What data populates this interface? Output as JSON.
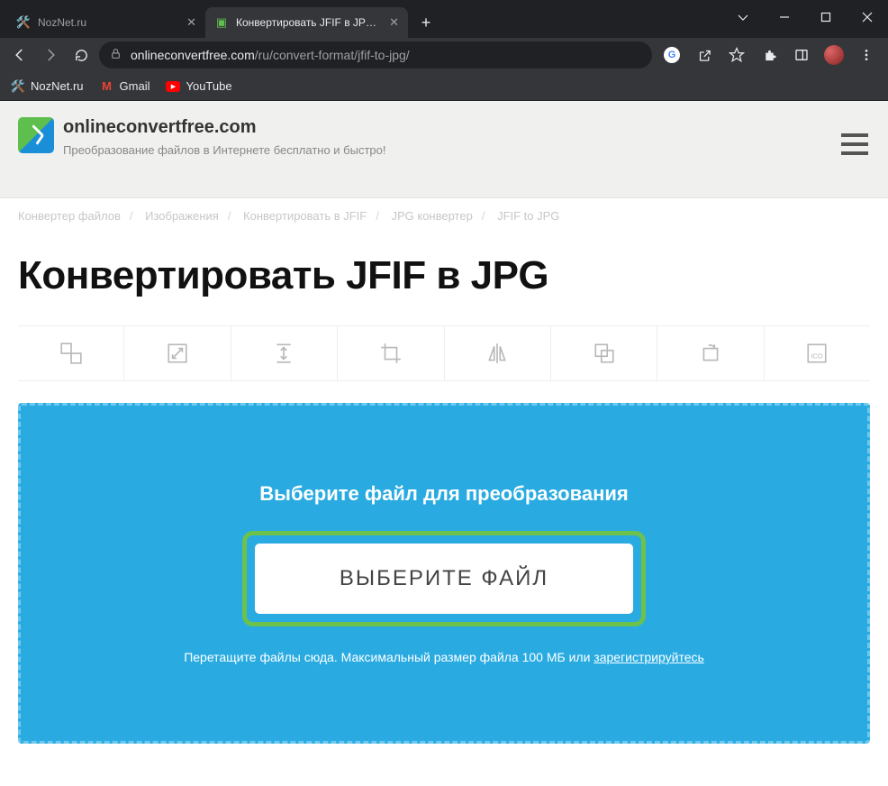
{
  "tabs": [
    {
      "title": "NozNet.ru"
    },
    {
      "title": "Конвертировать JFIF в JPG онла"
    }
  ],
  "url": {
    "host": "onlineconvertfree.com",
    "path": "/ru/convert-format/jfif-to-jpg/"
  },
  "bookmarks": [
    {
      "label": "NozNet.ru"
    },
    {
      "label": "Gmail"
    },
    {
      "label": "YouTube"
    }
  ],
  "site": {
    "title": "onlineconvertfree.com",
    "subtitle": "Преобразование файлов в Интернете бесплатно и быстро!"
  },
  "breadcrumbs": [
    "Конвертер файлов",
    "Изображения",
    "Конвертировать в JFIF",
    "JPG конвертер",
    "JFIF to JPG"
  ],
  "heading": "Конвертировать JFIF в JPG",
  "dropzone": {
    "title": "Выберите файл для преобразования",
    "button": "ВЫБЕРИТЕ ФАЙЛ",
    "hint_prefix": "Перетащите файлы сюда. Максимальный размер файла 100 МБ или ",
    "hint_link": "зарегистрируйтесь"
  }
}
